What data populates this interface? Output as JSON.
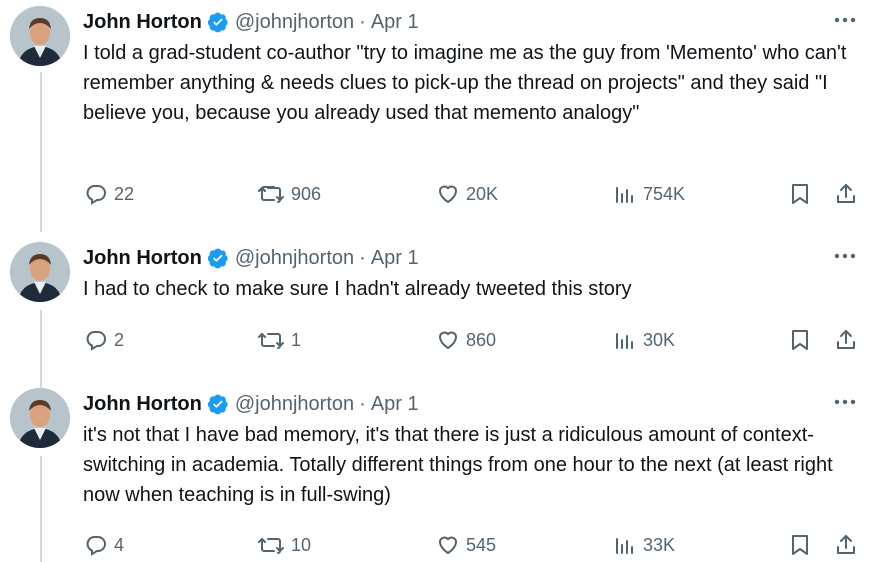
{
  "tweets": [
    {
      "author": "John Horton",
      "handle": "@johnjhorton",
      "separator": "·",
      "date": "Apr 1",
      "text": "I told a grad-student co-author \"try to imagine me as the guy from 'Memento' who can't remember anything & needs clues to pick-up the thread on projects\" and they said \"I believe you, because you already used that memento analogy\"",
      "replies": "22",
      "retweets": "906",
      "likes": "20K",
      "views": "754K"
    },
    {
      "author": "John Horton",
      "handle": "@johnjhorton",
      "separator": "·",
      "date": "Apr 1",
      "text": "I had to check to make sure I hadn't already tweeted this story",
      "replies": "2",
      "retweets": "1",
      "likes": "860",
      "views": "30K"
    },
    {
      "author": "John Horton",
      "handle": "@johnjhorton",
      "separator": "·",
      "date": "Apr 1",
      "text": "it's not that I have bad memory, it's that there is just a ridiculous amount of context-switching in academia. Totally different things from one hour to the next (at least right now when teaching is in full-swing)",
      "replies": "4",
      "retweets": "10",
      "likes": "545",
      "views": "33K"
    }
  ],
  "colors": {
    "verified": "#1d9bf0",
    "secondary_text": "#536471",
    "thread_line": "#cfd9de"
  },
  "icons": [
    "verified-badge-icon",
    "more-icon",
    "reply-icon",
    "retweet-icon",
    "like-icon",
    "views-icon",
    "bookmark-icon",
    "share-icon"
  ]
}
